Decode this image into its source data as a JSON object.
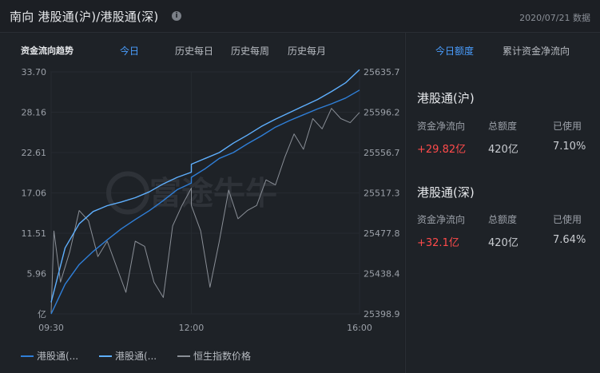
{
  "header": {
    "title": "南向 港股通(沪)/港股通(深)",
    "info_icon": "info-icon",
    "date_text": "2020/07/21 数据"
  },
  "chart_tabs": {
    "section_label": "资金流向趋势",
    "tabs": [
      "今日",
      "历史每日",
      "历史每周",
      "历史每月"
    ],
    "active": "今日"
  },
  "chart_data": {
    "type": "line",
    "x_ticks": [
      "09:30",
      "12:00",
      "16:00"
    ],
    "y_left_ticks": [
      "33.70",
      "28.16",
      "22.61",
      "17.06",
      "11.51",
      "5.96",
      "亿"
    ],
    "y_right_ticks": [
      "25635.7",
      "25596.2",
      "25556.7",
      "25517.3",
      "25477.8",
      "25438.4",
      "25398.9"
    ],
    "y_left_range": [
      0.41,
      33.7
    ],
    "y_right_range": [
      25398.9,
      25635.7
    ],
    "watermark": "富途牛牛",
    "series": [
      {
        "name": "港股通(...",
        "color": "#2f7fd8",
        "axis": "left",
        "x": [
          "09:30",
          "09:45",
          "10:00",
          "10:15",
          "10:30",
          "10:45",
          "11:00",
          "11:15",
          "11:30",
          "11:45",
          "12:00",
          "13:00",
          "13:15",
          "13:30",
          "13:45",
          "14:00",
          "14:15",
          "14:30",
          "14:45",
          "15:00",
          "15:15",
          "15:30",
          "15:45",
          "16:00"
        ],
        "values": [
          0.4,
          4.5,
          7.2,
          9.0,
          10.6,
          12.1,
          13.4,
          14.6,
          16.0,
          17.5,
          18.4,
          19.2,
          20.4,
          21.8,
          22.6,
          23.8,
          24.9,
          26.1,
          27.0,
          27.8,
          28.6,
          29.3,
          30.1,
          31.2
        ]
      },
      {
        "name": "港股通(...",
        "color": "#5fb0ff",
        "axis": "left",
        "x": [
          "09:30",
          "09:45",
          "10:00",
          "10:15",
          "10:30",
          "10:45",
          "11:00",
          "11:15",
          "11:30",
          "11:45",
          "12:00",
          "13:00",
          "13:15",
          "13:30",
          "13:45",
          "14:00",
          "14:15",
          "14:30",
          "14:45",
          "15:00",
          "15:15",
          "15:30",
          "15:45",
          "16:00"
        ],
        "values": [
          2.0,
          9.5,
          12.8,
          14.5,
          15.3,
          15.8,
          16.4,
          17.2,
          18.3,
          19.2,
          19.9,
          21.0,
          21.8,
          22.6,
          23.9,
          25.0,
          26.2,
          27.2,
          28.1,
          29.0,
          29.9,
          31.0,
          32.2,
          34.0
        ]
      },
      {
        "name": "恒生指数价格",
        "color": "#8a8f97",
        "axis": "right",
        "x": [
          "09:30",
          "09:33",
          "09:40",
          "09:50",
          "10:00",
          "10:10",
          "10:20",
          "10:30",
          "10:40",
          "10:50",
          "11:00",
          "11:10",
          "11:20",
          "11:30",
          "11:40",
          "11:50",
          "12:00",
          "13:00",
          "13:10",
          "13:20",
          "13:30",
          "13:40",
          "13:50",
          "14:00",
          "14:10",
          "14:20",
          "14:30",
          "14:40",
          "14:50",
          "15:00",
          "15:10",
          "15:20",
          "15:30",
          "15:40",
          "15:50",
          "16:00"
        ],
        "values": [
          25400,
          25480,
          25430,
          25460,
          25500,
          25490,
          25455,
          25470,
          25445,
          25420,
          25470,
          25465,
          25430,
          25415,
          25485,
          25505,
          25522,
          25505,
          25480,
          25425,
          25470,
          25520,
          25492,
          25500,
          25505,
          25530,
          25525,
          25552,
          25575,
          25560,
          25590,
          25580,
          25600,
          25590,
          25586,
          25596
        ]
      }
    ]
  },
  "legend": {
    "items": [
      {
        "label": "港股通(...",
        "color": "#2f7fd8"
      },
      {
        "label": "港股通(...",
        "color": "#5fb0ff"
      },
      {
        "label": "恒生指数价格",
        "color": "#8a8f97"
      }
    ]
  },
  "quota_panel": {
    "tabs": [
      "今日额度",
      "累计资金净流向"
    ],
    "active": "今日额度",
    "sections": [
      {
        "title": "港股通(沪)",
        "headers": [
          "资金净流向",
          "总额度",
          "已使用"
        ],
        "net_flow": "+29.82亿",
        "total": "420亿",
        "used": "7.10%"
      },
      {
        "title": "港股通(深)",
        "headers": [
          "资金净流向",
          "总额度",
          "已使用"
        ],
        "net_flow": "+32.1亿",
        "total": "420亿",
        "used": "7.64%"
      }
    ]
  }
}
